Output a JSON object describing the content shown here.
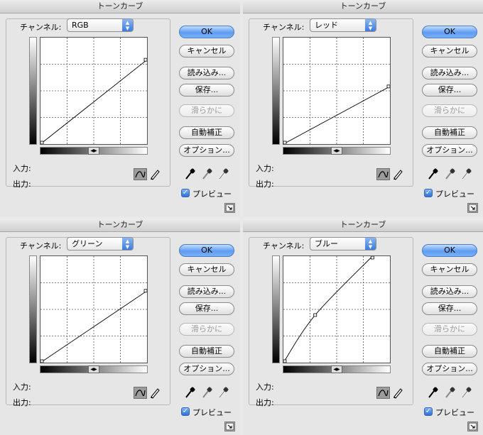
{
  "panels": [
    {
      "title": "トーンカーブ",
      "channel_label": "チャンネル:",
      "channel_value": "RGB",
      "input_label": "入力:",
      "output_label": "出力:",
      "buttons": {
        "ok": "OK",
        "cancel": "キャンセル",
        "load": "読み込み...",
        "save": "保存...",
        "smooth": "滑らかに",
        "auto": "自動補正",
        "options": "オプション..."
      },
      "preview_label": "プレビュー",
      "preview_checked": true
    },
    {
      "title": "トーンカーブ",
      "channel_label": "チャンネル:",
      "channel_value": "レッド",
      "input_label": "入力:",
      "output_label": "出力:",
      "buttons": {
        "ok": "OK",
        "cancel": "キャンセル",
        "load": "読み込み...",
        "save": "保存...",
        "smooth": "滑らかに",
        "auto": "自動補正",
        "options": "オプション..."
      },
      "preview_label": "プレビュー",
      "preview_checked": true
    },
    {
      "title": "トーンカーブ",
      "channel_label": "チャンネル:",
      "channel_value": "グリーン",
      "input_label": "入力:",
      "output_label": "出力:",
      "buttons": {
        "ok": "OK",
        "cancel": "キャンセル",
        "load": "読み込み...",
        "save": "保存...",
        "smooth": "滑らかに",
        "auto": "自動補正",
        "options": "オプション..."
      },
      "preview_label": "プレビュー",
      "preview_checked": true
    },
    {
      "title": "トーンカーブ",
      "channel_label": "チャンネル:",
      "channel_value": "ブルー",
      "input_label": "入力:",
      "output_label": "出力:",
      "buttons": {
        "ok": "OK",
        "cancel": "キャンセル",
        "load": "読み込み...",
        "save": "保存...",
        "smooth": "滑らかに",
        "auto": "自動補正",
        "options": "オプション..."
      },
      "preview_label": "プレビュー",
      "preview_checked": true
    }
  ],
  "chart_data": [
    {
      "type": "line",
      "channel": "RGB",
      "points": [
        [
          0,
          0
        ],
        [
          255,
          202
        ]
      ],
      "xlim": [
        0,
        255
      ],
      "ylim": [
        0,
        255
      ],
      "grid": true
    },
    {
      "type": "line",
      "channel": "レッド",
      "points": [
        [
          0,
          0
        ],
        [
          255,
          138
        ]
      ],
      "xlim": [
        0,
        255
      ],
      "ylim": [
        0,
        255
      ],
      "grid": true
    },
    {
      "type": "line",
      "channel": "グリーン",
      "points": [
        [
          0,
          0
        ],
        [
          255,
          172
        ]
      ],
      "xlim": [
        0,
        255
      ],
      "ylim": [
        0,
        255
      ],
      "grid": true
    },
    {
      "type": "line",
      "channel": "ブルー",
      "points": [
        [
          0,
          0
        ],
        [
          76,
          114
        ],
        [
          213,
          255
        ]
      ],
      "xlim": [
        0,
        255
      ],
      "ylim": [
        0,
        255
      ],
      "grid": true
    }
  ],
  "colors": {
    "accent": "#5e9cf2",
    "panel_bg": "#e6e6e6"
  },
  "icons": {
    "curve_tool": "curve-icon",
    "pencil_tool": "pencil-icon",
    "eyedroppers": [
      "black-eyedropper-icon",
      "gray-eyedropper-icon",
      "white-eyedropper-icon"
    ],
    "expand": "expand-view-icon"
  }
}
